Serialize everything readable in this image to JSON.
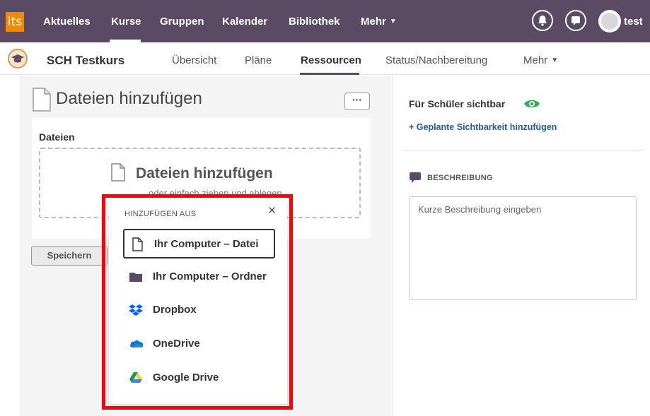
{
  "topbar": {
    "logo": "its",
    "nav": [
      "Aktuelles",
      "Kurse",
      "Gruppen",
      "Kalender",
      "Bibliothek",
      "Mehr"
    ],
    "active": "Kurse",
    "user": "test"
  },
  "coursebar": {
    "title": "SCH Testkurs",
    "tabs": [
      "Übersicht",
      "Pläne",
      "Ressourcen",
      "Status/Nachbereitung",
      "Mehr"
    ],
    "active": "Ressourcen"
  },
  "main": {
    "title": "Dateien hinzufügen",
    "more_label": "···",
    "files_label": "Dateien",
    "dropzone_title": "Dateien hinzufügen",
    "dropzone_sub": "oder einfach ziehen und ablegen",
    "save_label": "Speichern"
  },
  "right": {
    "visibility_label": "Für Schüler sichtbar",
    "add_visibility": "+ Geplante Sichtbarkeit hinzufügen",
    "description_label": "BESCHREIBUNG",
    "description_placeholder": "Kurze Beschreibung eingeben"
  },
  "popover": {
    "title": "HINZUFÜGEN AUS",
    "close": "×",
    "items": [
      {
        "label": "Ihr Computer – Datei",
        "icon": "file-icon",
        "selected": true
      },
      {
        "label": "Ihr Computer – Ordner",
        "icon": "folder-icon",
        "selected": false
      },
      {
        "label": "Dropbox",
        "icon": "dropbox-icon",
        "selected": false
      },
      {
        "label": "OneDrive",
        "icon": "onedrive-icon",
        "selected": false
      },
      {
        "label": "Google Drive",
        "icon": "google-drive-icon",
        "selected": false
      }
    ]
  },
  "colors": {
    "topbar": "#5b4a63",
    "logo": "#f08a00",
    "link": "#1f5aa6",
    "eye": "#2bb24c",
    "highlight": "#ff0000"
  }
}
